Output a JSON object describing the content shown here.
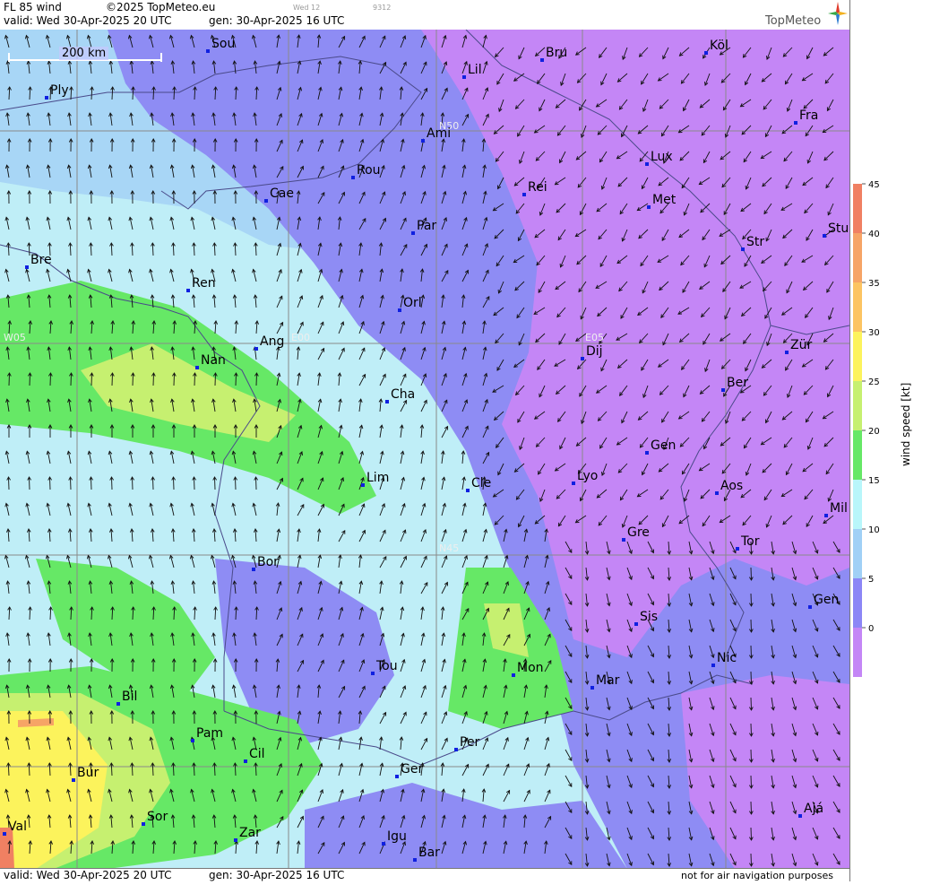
{
  "header": {
    "title": "FL 85 wind",
    "copyright": "©2025 TopMeteo.eu",
    "weekday_label": "Wed 12",
    "code": "9312",
    "valid_line": "valid:  Wed  30-Apr-2025  20 UTC",
    "gen_line": "gen: 30-Apr-2025 16 UTC",
    "brand": "TopMeteo"
  },
  "footer": {
    "valid_line": "valid:  Wed  30-Apr-2025  20 UTC",
    "gen_line": "gen: 30-Apr-2025 16 UTC",
    "disclaimer": "not for air navigation purposes"
  },
  "map": {
    "scale_label": "200 km",
    "grid_labels": [
      "N50",
      "N45",
      "W05",
      "E00",
      "E05"
    ],
    "cities": [
      "Sou",
      "Ply",
      "Lil",
      "Bru",
      "Köl",
      "Fra",
      "Ami",
      "Lux",
      "Rou",
      "Cae",
      "Rei",
      "Met",
      "Par",
      "Bre",
      "Str",
      "Stu",
      "Ren",
      "Orl",
      "Ang",
      "Nan",
      "Dij",
      "Zür",
      "Ber",
      "Cha",
      "Gen",
      "Lim",
      "Cle",
      "Lyo",
      "Aos",
      "Mil",
      "Gre",
      "Tor",
      "Bor",
      "Sis",
      "Gen",
      "Nic",
      "Tou",
      "Mon",
      "Mar",
      "Bil",
      "Pam",
      "Cil",
      "Per",
      "Bur",
      "Ger",
      "Sor",
      "Ajá",
      "Val",
      "Zar",
      "Igu",
      "Bar"
    ]
  },
  "legend": {
    "title": "wind speed [kt]",
    "ticks": [
      "45",
      "40",
      "35",
      "30",
      "25",
      "20",
      "15",
      "10",
      "5",
      "0"
    ],
    "colors": [
      "#f08062",
      "#f6a466",
      "#fcc462",
      "#fcf35c",
      "#c6f070",
      "#66e866",
      "#b8f6fa",
      "#a0d0f6",
      "#8c86f6",
      "#c486f6"
    ]
  }
}
